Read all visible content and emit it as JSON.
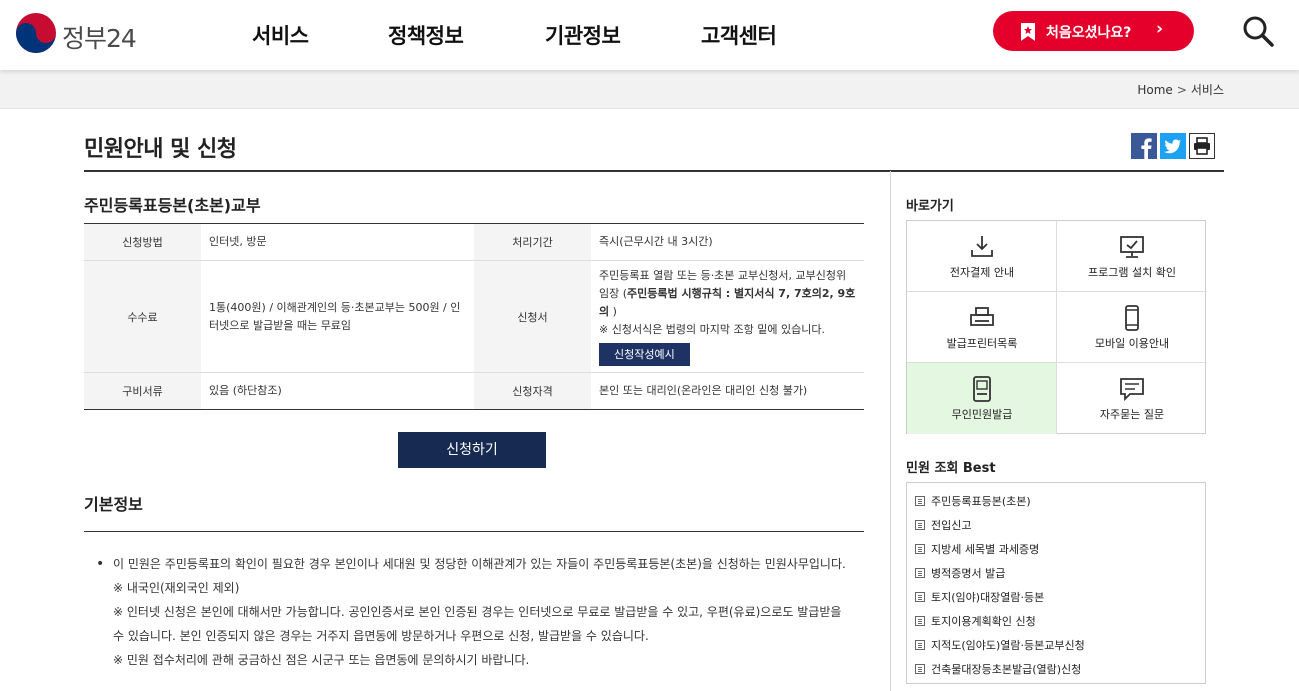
{
  "header": {
    "logo_text": "정부24",
    "nav": [
      "서비스",
      "정책정보",
      "기관정보",
      "고객센터"
    ],
    "first_visit": "처음오셨나요?",
    "first_visit_arrow": "›"
  },
  "breadcrumb": {
    "home": "Home",
    "sep": ">",
    "current": "서비스"
  },
  "page": {
    "title": "민원안내 및 신청"
  },
  "service": {
    "title": "주민등록표등본(초본)교부",
    "rows": [
      {
        "h1": "신청방법",
        "v1": "인터넷, 방문",
        "h2": "처리기간",
        "v2": "즉시(근무시간 내 3시간)"
      },
      {
        "h1": "수수료",
        "v1": "1통(400원) / 이해관계인의 등·초본교부는 500원 / 인터넷으로 발급받을 때는 무료임",
        "h2": "신청서",
        "v2_text": "주민등록표 열람 또는 등·초본 교부신청서, 교부신청위임장 (",
        "v2_bold": "주민등록법 시행규칙 : 별지서식 7, 7호의2, 9호의",
        "v2_close": " )",
        "v2_note": "※ 신청서식은 법령의 마지막 조항 밑에 있습니다.",
        "v2_button": "신청작성예시"
      },
      {
        "h1": "구비서류",
        "v1": "있음 (하단참조)",
        "h2": "신청자격",
        "v2": "본인 또는 대리인(온라인은 대리인 신청 불가)"
      }
    ],
    "apply_button": "신청하기"
  },
  "basic": {
    "title": "기본정보",
    "bullet": "•",
    "lines": [
      "이 민원은 주민등록표의 확인이 필요한 경우 본인이나 세대원 및 정당한 이해관계가 있는 자들이 주민등록표등본(초본)을 신청하는 민원사무입니다.",
      "※ 내국인(재외국인 제외)",
      "※ 인터넷 신청은 본인에 대해서만 가능합니다. 공인인증서로 본인 인증된 경우는 인터넷으로 무료로 발급받을 수 있고, 우편(유료)으로도 발급받을 수 있습니다. 본인 인증되지 않은 경우는 거주지 읍면동에 방문하거나 우편으로 신청, 발급받을 수 있습니다.",
      "※ 민원 접수처리에 관해 궁금하신 점은 시군구 또는 읍면동에 문의하시기 바랍니다."
    ]
  },
  "sidebar": {
    "shortcut_title": "바로가기",
    "shortcuts": [
      {
        "label": "전자결제 안내",
        "icon": "download-icon"
      },
      {
        "label": "프로그램 설치 확인",
        "icon": "monitor-check-icon"
      },
      {
        "label": "발급프린터목록",
        "icon": "printer-icon"
      },
      {
        "label": "모바일 이용안내",
        "icon": "mobile-icon"
      },
      {
        "label": "무인민원발급",
        "icon": "kiosk-icon"
      },
      {
        "label": "자주묻는 질문",
        "icon": "chat-icon"
      }
    ],
    "best_title": "민원 조회 Best",
    "best": [
      "주민등록표등본(초본)",
      "전입신고",
      "지방세 세목별 과세증명",
      "병적증명서 발급",
      "토지(임야)대장열람·등본",
      "토지이용계획확인 신청",
      "지적도(임야도)열람·등본교부신청",
      "건축물대장등초본발급(열람)신청"
    ]
  },
  "colors": {
    "accent_red": "#e4002b",
    "navy": "#162a52",
    "highlight_green": "#e4f7e0"
  }
}
